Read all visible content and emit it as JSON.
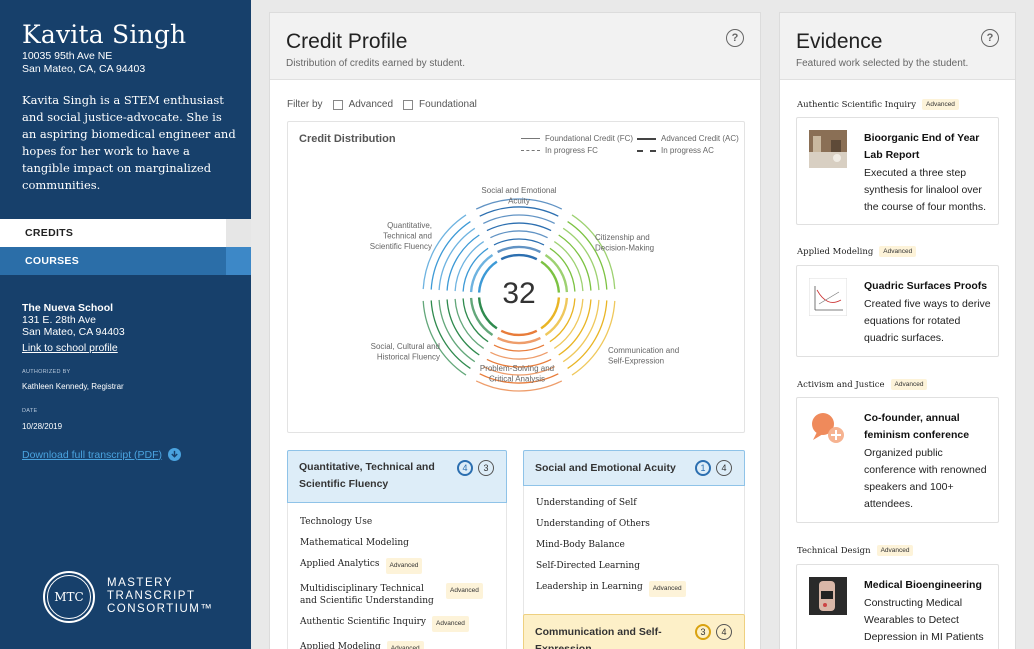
{
  "student": {
    "name": "Kavita Singh",
    "address_line1": "10035 95th Ave NE",
    "address_line2": "San Mateo, CA, CA 94403",
    "bio": "Kavita Singh is a STEM enthusiast and social justice-advocate. She is an aspiring biomedical engineer and hopes for her work to have a tangible impact on marginalized communities."
  },
  "nav": {
    "credits": "CREDITS",
    "courses": "COURSES"
  },
  "school": {
    "name": "The Nueva School",
    "address_line1": "131 E. 28th Ave",
    "address_line2": "San Mateo, CA 94403",
    "link": "Link to school profile",
    "authorized_label": "AUTHORIZED BY",
    "authorized_value": "Kathleen Kennedy, Registrar",
    "date_label": "DATE",
    "date_value": "10/28/2019",
    "download": "Download full transcript (PDF)"
  },
  "logo": {
    "mark": "MTC",
    "line1": "MASTERY",
    "line2": "TRANSCRIPT",
    "line3": "CONSORTIUM™"
  },
  "credit_profile": {
    "title": "Credit Profile",
    "subtitle": "Distribution of credits earned by student.",
    "filter_label": "Filter by",
    "filter_advanced": "Advanced",
    "filter_foundational": "Foundational",
    "dist_title": "Credit Distribution",
    "legend": {
      "fc": "Foundational Credit (FC)",
      "fc_progress": "In progress FC",
      "ac": "Advanced Credit (AC)",
      "ac_progress": "In progress AC"
    },
    "total": "32",
    "segments": [
      {
        "label1": "Social and Emotional",
        "label2": "Acuity",
        "label3": "",
        "color": "#2c6fb0"
      },
      {
        "label1": "Citizenship and",
        "label2": "Decision-Making",
        "label3": "",
        "color": "#7cc242"
      },
      {
        "label1": "Communication and",
        "label2": "Self-Expression",
        "label3": "",
        "color": "#e9b525"
      },
      {
        "label1": "Problem-Solving and",
        "label2": "Critical Analysis",
        "label3": "",
        "color": "#e87c3a"
      },
      {
        "label1": "Social, Cultural and",
        "label2": "Historical Fluency",
        "label3": "",
        "color": "#2f8a4e"
      },
      {
        "label1": "Quantitative,",
        "label2": "Technical and",
        "label3": "Scientific Fluency",
        "color": "#3d9ad6"
      }
    ]
  },
  "categories": [
    {
      "title": "Quantitative, Technical and Scientific Fluency",
      "count_a": "4",
      "count_b": "3",
      "skills": [
        {
          "name": "Technology Use",
          "badge": ""
        },
        {
          "name": "Mathematical Modeling",
          "badge": ""
        },
        {
          "name": "Applied Analytics",
          "badge": "Advanced"
        },
        {
          "name": "Multidisciplinary Technical and Scientific Understanding",
          "badge": "Advanced"
        },
        {
          "name": "Authentic Scientific Inquiry",
          "badge": "Advanced"
        },
        {
          "name": "Applied Modeling",
          "badge": "Advanced"
        }
      ]
    },
    {
      "title": "Social and Emotional Acuity",
      "count_a": "1",
      "count_b": "4",
      "skills": [
        {
          "name": "Understanding of Self",
          "badge": ""
        },
        {
          "name": "Understanding of Others",
          "badge": ""
        },
        {
          "name": "Mind-Body Balance",
          "badge": ""
        },
        {
          "name": "Self-Directed Learning",
          "badge": ""
        },
        {
          "name": "Leadership in Learning",
          "badge": "Advanced"
        }
      ]
    },
    {
      "title": "Communication and Self-Expression",
      "count_a": "3",
      "count_b": "4",
      "skills": []
    }
  ],
  "evidence": {
    "title": "Evidence",
    "subtitle": "Featured work selected by the student.",
    "items": [
      {
        "category": "Authentic Scientific Inquiry",
        "badge": "Advanced",
        "title": "Bioorganic End of Year Lab Report",
        "desc": "Executed a three step synthesis for linalool over the course of four months.",
        "thumb": "lab-photo"
      },
      {
        "category": "Applied Modeling",
        "badge": "Advanced",
        "title": "Quadric Surfaces Proofs",
        "desc": "Created five ways to derive equations for rotated quadric surfaces.",
        "thumb": "graph-sketch"
      },
      {
        "category": "Activism and Justice",
        "badge": "Advanced",
        "title": "Co-founder, annual feminism conference",
        "desc": "Organized public conference with renowned speakers and 100+ attendees.",
        "thumb": "speech-bubbles"
      },
      {
        "category": "Technical Design",
        "badge": "Advanced",
        "title": "Medical Bioengineering",
        "desc": "Constructing Medical Wearables to Detect Depression in MI Patients",
        "thumb": "wearable-photo"
      }
    ]
  }
}
